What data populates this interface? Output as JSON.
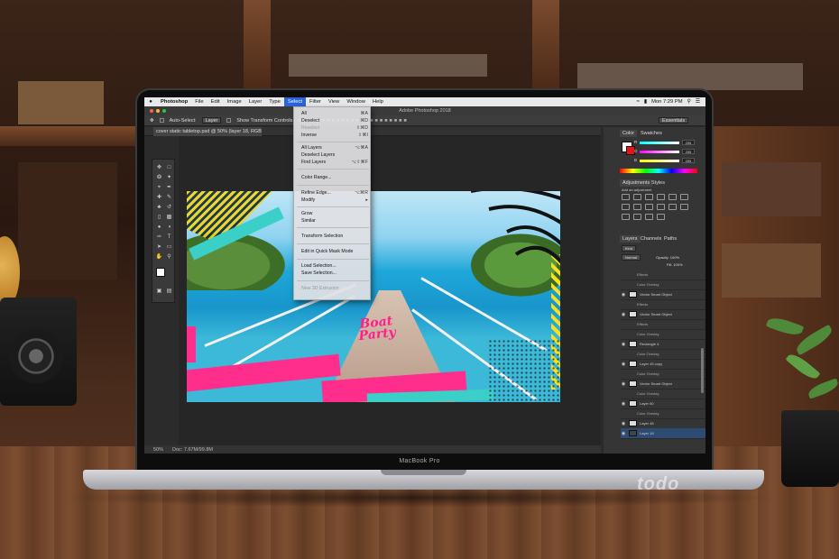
{
  "menubar": {
    "app": "Photoshop",
    "items": [
      "File",
      "Edit",
      "Image",
      "Layer",
      "Type",
      "Select",
      "Filter",
      "View",
      "Window",
      "Help"
    ],
    "active": "Select",
    "clock": "Mon 7:29 PM"
  },
  "titlebar": {
    "title": "Adobe Photoshop 2018"
  },
  "options": {
    "auto_select": "Auto-Select:",
    "layer": "Layer",
    "transform": "Show Transform Controls",
    "workspace": "Essentials"
  },
  "document": {
    "tab": "cover static tabletop.psd @ 50% (layer 18, RGB/8) *",
    "zoom": "50%",
    "doc_size": "Doc: 7.67M/99.8M"
  },
  "select_menu": {
    "items": [
      {
        "label": "All",
        "shortcut": "⌘A",
        "disabled": false
      },
      {
        "label": "Deselect",
        "shortcut": "⌘D",
        "disabled": false
      },
      {
        "label": "Reselect",
        "shortcut": "⇧⌘D",
        "disabled": true
      },
      {
        "label": "Inverse",
        "shortcut": "⇧⌘I",
        "disabled": false
      },
      {
        "label": "All Layers",
        "shortcut": "⌥⌘A",
        "disabled": false
      },
      {
        "label": "Deselect Layers",
        "shortcut": "",
        "disabled": false
      },
      {
        "label": "Find Layers",
        "shortcut": "⌥⇧⌘F",
        "disabled": false
      },
      {
        "label": "Color Range...",
        "shortcut": "",
        "disabled": false
      },
      {
        "label": "Refine Edge...",
        "shortcut": "⌥⌘R",
        "disabled": false
      },
      {
        "label": "Modify",
        "shortcut": "▸",
        "disabled": false
      },
      {
        "label": "Grow",
        "shortcut": "",
        "disabled": false
      },
      {
        "label": "Similar",
        "shortcut": "",
        "disabled": false
      },
      {
        "label": "Transform Selection",
        "shortcut": "",
        "disabled": false
      },
      {
        "label": "Edit in Quick Mask Mode",
        "shortcut": "",
        "disabled": false
      },
      {
        "label": "Load Selection...",
        "shortcut": "",
        "disabled": false
      },
      {
        "label": "Save Selection...",
        "shortcut": "",
        "disabled": false
      },
      {
        "label": "New 3D Extrusion",
        "shortcut": "",
        "disabled": true
      }
    ]
  },
  "artwork": {
    "line1": "Boat",
    "line2": "Party"
  },
  "panels": {
    "color_tabs": [
      "Color",
      "Swatches"
    ],
    "sliders": [
      {
        "label": "R",
        "value": "255"
      },
      {
        "label": "G",
        "value": "255"
      },
      {
        "label": "B",
        "value": "255"
      }
    ],
    "adj_tabs": [
      "Adjustments",
      "Styles"
    ],
    "adj_title": "Add an adjustment",
    "layer_tabs": [
      "Layers",
      "Channels",
      "Paths"
    ],
    "layer_kind": "Kind",
    "blend": "Normal",
    "opacity": "Opacity: 100%",
    "fill": "Fill: 100%",
    "layers": [
      {
        "name": "Effects",
        "fx": true
      },
      {
        "name": "Color Overlay",
        "fx": true
      },
      {
        "name": "Vector Smart Object",
        "fx": false
      },
      {
        "name": "Effects",
        "fx": true
      },
      {
        "name": "Vector Smart Object",
        "fx": false
      },
      {
        "name": "Effects",
        "fx": true
      },
      {
        "name": "Color Overlay",
        "fx": true
      },
      {
        "name": "Rectangle 4",
        "fx": false
      },
      {
        "name": "Color Overlay",
        "fx": true
      },
      {
        "name": "Layer 45 copy",
        "fx": false
      },
      {
        "name": "Color Overlay",
        "fx": true
      },
      {
        "name": "Vector Smart Object",
        "fx": false
      },
      {
        "name": "Color Overlay",
        "fx": true
      },
      {
        "name": "Layer 50",
        "fx": false
      },
      {
        "name": "Color Overlay",
        "fx": true
      },
      {
        "name": "Layer 48",
        "fx": false
      },
      {
        "name": "Layer 18",
        "fx": false,
        "selected": true
      }
    ]
  },
  "laptop": {
    "brand": "MacBook Pro"
  },
  "watermark": {
    "text": "todo"
  }
}
